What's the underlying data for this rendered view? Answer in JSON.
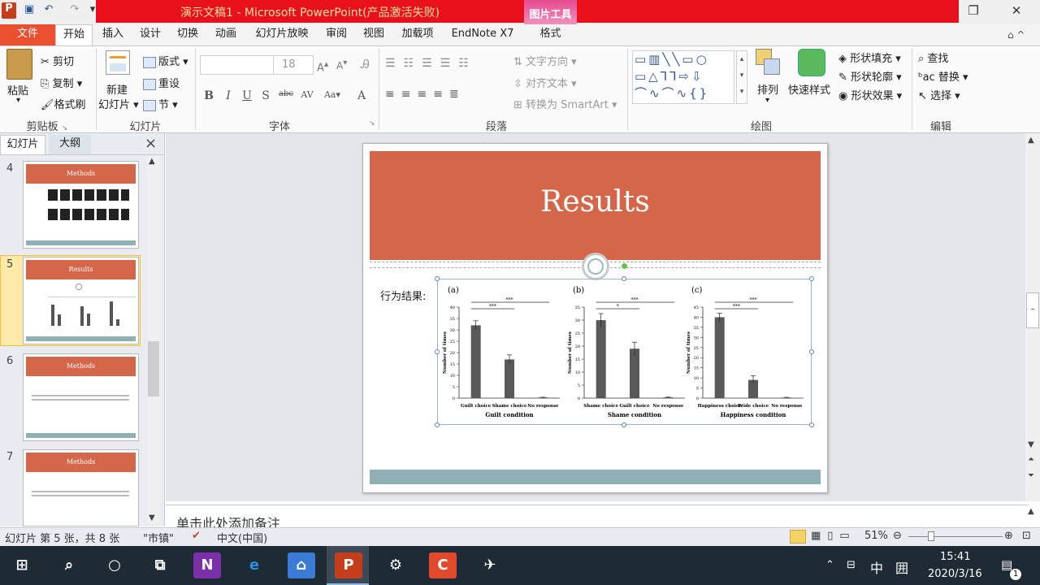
{
  "window": {
    "title": "演示文稿1 - Microsoft PowerPoint(产品激活失败)",
    "context_tab_title": "图片工具"
  },
  "tabs": {
    "file": "文件",
    "home": "开始",
    "insert": "插入",
    "design": "设计",
    "transitions": "切换",
    "animations": "动画",
    "slideshow": "幻灯片放映",
    "review": "审阅",
    "view": "视图",
    "addins": "加载项",
    "endnote": "EndNote X7",
    "format": "格式"
  },
  "ribbon": {
    "paste": "粘贴",
    "cut": "剪切",
    "copy": "复制",
    "format_painter": "格式刷",
    "clipboard_group": "剪贴板",
    "new_slide_1": "新建",
    "new_slide_2": "幻灯片",
    "layout": "版式",
    "reset": "重设",
    "section": "节",
    "slides_group": "幻灯片",
    "font_size": "18",
    "font_group": "字体",
    "text_direction": "文字方向",
    "align_text": "对齐文本",
    "smartart": "转换为 SmartArt",
    "paragraph_group": "段落",
    "arrange": "排列",
    "quick_styles": "快速样式",
    "shape_fill": "形状填充",
    "shape_outline": "形状轮廓",
    "shape_effects": "形状效果",
    "drawing_group": "绘图",
    "find": "查找",
    "replace": "替换",
    "select": "选择",
    "editing_group": "编辑"
  },
  "panel": {
    "tab_slides": "幻灯片",
    "tab_outline": "大纲",
    "close": "×",
    "thumbs": [
      {
        "num": "4",
        "title": "Methods"
      },
      {
        "num": "5",
        "title": "Results"
      },
      {
        "num": "6",
        "title": "Methods"
      },
      {
        "num": "7",
        "title": "Methods"
      }
    ]
  },
  "slide": {
    "title": "Results",
    "behavior_label": "行为结果:"
  },
  "notes": {
    "placeholder": "单击此处添加备注"
  },
  "status": {
    "slide_info": "幻灯片 第 5 张，共 8 张",
    "theme": "\"市镇\"",
    "language": "中文(中国)",
    "zoom": "51%"
  },
  "taskbar": {
    "time": "15:41",
    "date": "2020/3/16",
    "ime": "中",
    "notif": "1"
  },
  "chart_data": [
    {
      "type": "bar",
      "panel": "(a)",
      "categories": [
        "Guilt choice",
        "Shame choice",
        "No response"
      ],
      "values": [
        32,
        17,
        0.3
      ],
      "errors": [
        2,
        2,
        0.1
      ],
      "xlabel": "Guilt condition",
      "ylabel": "Number of times",
      "ylim": [
        0,
        40
      ],
      "yticks": [
        0,
        5,
        10,
        15,
        20,
        25,
        30,
        35,
        40
      ],
      "significance": [
        "***",
        "***"
      ]
    },
    {
      "type": "bar",
      "panel": "(b)",
      "categories": [
        "Shame choice",
        "Guilt choice",
        "No response"
      ],
      "values": [
        30,
        19,
        0.3
      ],
      "errors": [
        2.5,
        2.5,
        0.1
      ],
      "xlabel": "Shame condition",
      "ylabel": "Number of times",
      "ylim": [
        0,
        35
      ],
      "yticks": [
        0,
        5,
        10,
        15,
        20,
        25,
        30,
        35
      ],
      "significance": [
        "*",
        "***"
      ]
    },
    {
      "type": "bar",
      "panel": "(c)",
      "categories": [
        "Happiness choice",
        "Pride choice",
        "No response"
      ],
      "values": [
        40,
        9,
        0.3
      ],
      "errors": [
        2,
        2,
        0.1
      ],
      "xlabel": "Happiness condition",
      "ylabel": "Number of times",
      "ylim": [
        0,
        45
      ],
      "yticks": [
        0,
        5,
        10,
        15,
        20,
        25,
        30,
        35,
        40,
        45
      ],
      "significance": [
        "***",
        "***"
      ]
    }
  ]
}
